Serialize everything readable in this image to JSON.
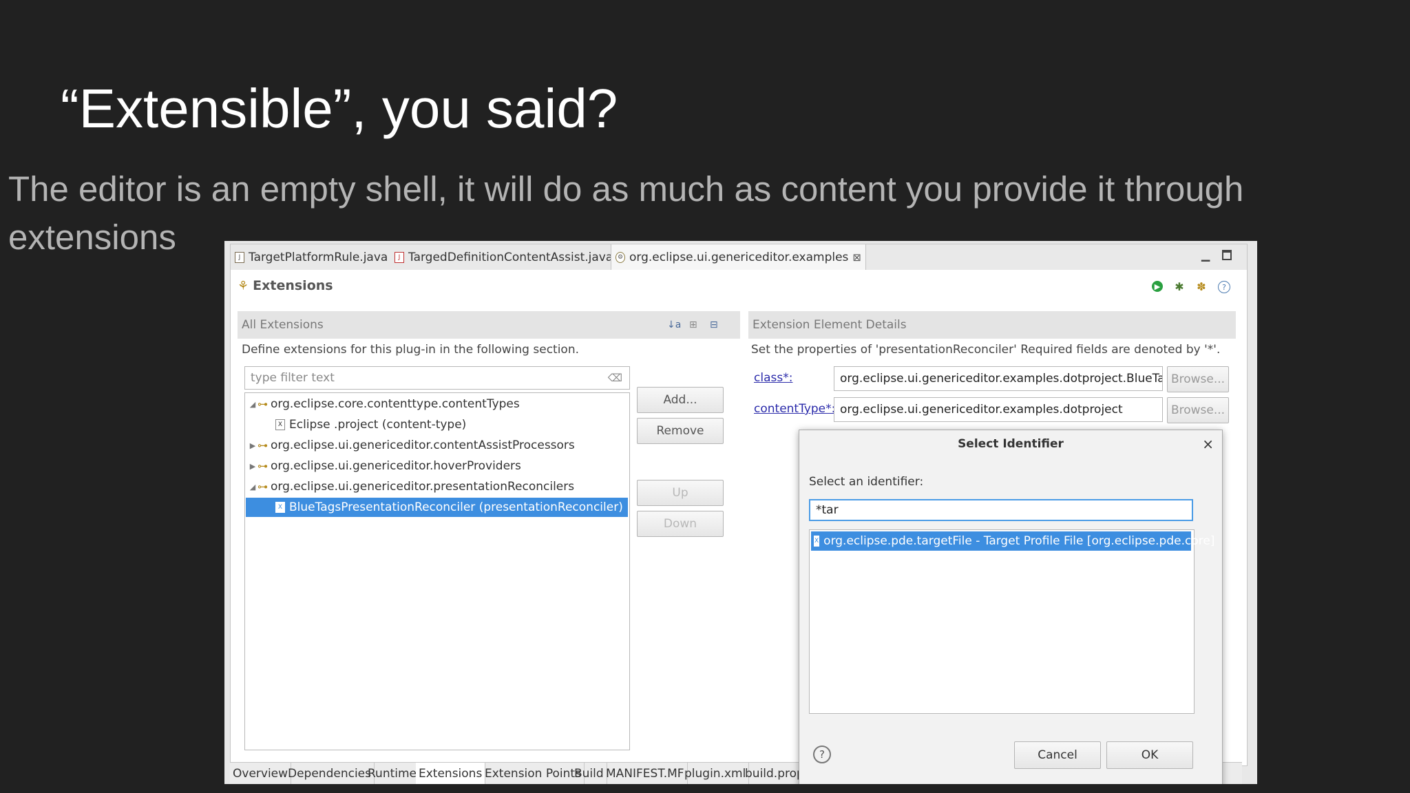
{
  "slide": {
    "title": "“Extensible”, you said?",
    "subtitle": "The editor is an empty shell, it will do as much as content you provide it through extensions"
  },
  "editor": {
    "tabs": [
      {
        "label": "TargetPlatformRule.java",
        "icon": "java-file-icon"
      },
      {
        "label": "TargedDefinitionContentAssist.java",
        "icon": "java-file-error-icon"
      },
      {
        "label": "org.eclipse.ui.genericeditor.examples",
        "icon": "plugin-icon"
      }
    ],
    "close_tab": "⊠",
    "page_title": "Extensions",
    "all_extensions": {
      "header": "All Extensions",
      "description": "Define extensions for this plug-in in the following section.",
      "filter_placeholder": "type filter text",
      "tree": [
        {
          "label": "org.eclipse.core.contenttype.contentTypes",
          "level": 0,
          "expanded": true,
          "icon": "key-icon"
        },
        {
          "label": "Eclipse .project (content-type)",
          "level": 1,
          "icon": "element-icon"
        },
        {
          "label": "org.eclipse.ui.genericeditor.contentAssistProcessors",
          "level": 0,
          "expanded": false,
          "icon": "key-icon"
        },
        {
          "label": "org.eclipse.ui.genericeditor.hoverProviders",
          "level": 0,
          "expanded": false,
          "icon": "key-icon"
        },
        {
          "label": "org.eclipse.ui.genericeditor.presentationReconcilers",
          "level": 0,
          "expanded": true,
          "icon": "key-icon"
        },
        {
          "label": "BlueTagsPresentationReconciler (presentationReconciler)",
          "level": 1,
          "selected": true,
          "icon": "element-icon"
        }
      ],
      "buttons": {
        "add": "Add...",
        "remove": "Remove",
        "up": "Up",
        "down": "Down"
      }
    },
    "details": {
      "header": "Extension Element Details",
      "description": "Set the properties of 'presentationReconciler' Required fields are denoted by '*'.",
      "class_label": "class*:",
      "class_value": "org.eclipse.ui.genericeditor.examples.dotproject.BlueTagsPre:",
      "contenttype_label": "contentType*:",
      "contenttype_value": "org.eclipse.ui.genericeditor.examples.dotproject",
      "browse": "Browse..."
    },
    "bottom_tabs": [
      "Overview",
      "Dependencies",
      "Runtime",
      "Extensions",
      "Extension Points",
      "Build",
      "MANIFEST.MF",
      "plugin.xml",
      "build.prope"
    ],
    "active_bottom_tab": "Extensions"
  },
  "dialog": {
    "title": "Select Identifier",
    "close": "×",
    "prompt": "Select an identifier:",
    "input_value": "*tar",
    "results": [
      "org.eclipse.pde.targetFile - Target Profile File [org.eclipse.pde.core]"
    ],
    "help": "?",
    "cancel": "Cancel",
    "ok": "OK"
  },
  "colors": {
    "selection": "#3d8ee0",
    "slide_bg": "#212121",
    "link": "#2a2aaa"
  }
}
